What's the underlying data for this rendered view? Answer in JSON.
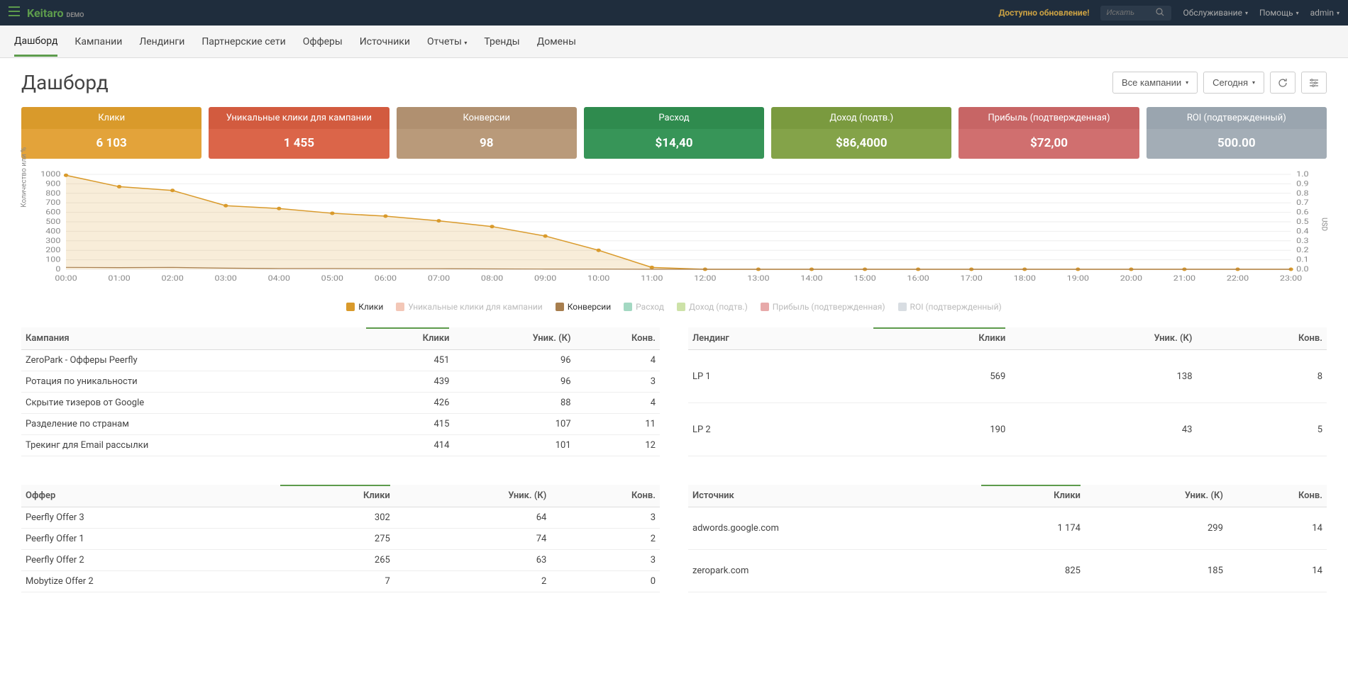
{
  "topbar": {
    "brand": "Keitaro",
    "demo": "DEMO",
    "update_notice": "Доступно обновление!",
    "search_placeholder": "Искать",
    "service": "Обслуживание",
    "help": "Помощь",
    "user": "admin"
  },
  "nav": {
    "items": [
      "Дашборд",
      "Кампании",
      "Лендинги",
      "Партнерские сети",
      "Офферы",
      "Источники",
      "Отчеты",
      "Тренды",
      "Домены"
    ]
  },
  "page": {
    "title": "Дашборд",
    "campaigns_dropdown": "Все кампании",
    "today_button": "Сегодня"
  },
  "stats": [
    {
      "label": "Клики",
      "value": "6 103",
      "cls": "card-orange"
    },
    {
      "label": "Уникальные клики для кампании",
      "value": "1 455",
      "cls": "card-red"
    },
    {
      "label": "Конверсии",
      "value": "98",
      "cls": "card-tan"
    },
    {
      "label": "Расход",
      "value": "$14,40",
      "cls": "card-green"
    },
    {
      "label": "Доход (подтв.)",
      "value": "$86,4000",
      "cls": "card-olive"
    },
    {
      "label": "Прибыль (подтвержденная)",
      "value": "$72,00",
      "cls": "card-salmon"
    },
    {
      "label": "ROI (подтвержденный)",
      "value": "500.00",
      "cls": "card-gray"
    }
  ],
  "chart_data": {
    "type": "area",
    "title": "",
    "xlabel": "",
    "ylabel_left": "Количество или %",
    "ylabel_right": "USD",
    "ylim_left": [
      0,
      1000
    ],
    "ylim_right": [
      0,
      1.0
    ],
    "y_ticks_left": [
      0,
      100,
      200,
      300,
      400,
      500,
      600,
      700,
      800,
      900,
      1000
    ],
    "y_ticks_right": [
      0.0,
      0.1,
      0.2,
      0.3,
      0.4,
      0.5,
      0.6,
      0.7,
      0.8,
      0.9,
      1.0
    ],
    "x": [
      "00:00",
      "01:00",
      "02:00",
      "03:00",
      "04:00",
      "05:00",
      "06:00",
      "07:00",
      "08:00",
      "09:00",
      "10:00",
      "11:00",
      "12:00",
      "13:00",
      "14:00",
      "15:00",
      "16:00",
      "17:00",
      "18:00",
      "19:00",
      "20:00",
      "21:00",
      "22:00",
      "23:00"
    ],
    "series": [
      {
        "name": "Клики",
        "color": "#d99a2b",
        "values": [
          990,
          870,
          830,
          670,
          640,
          590,
          560,
          510,
          450,
          350,
          200,
          20,
          0,
          0,
          0,
          0,
          0,
          0,
          0,
          0,
          0,
          0,
          0,
          0
        ]
      },
      {
        "name": "Уникальные клики для кампании",
        "color": "#f3c7b7",
        "values": [
          0,
          0,
          0,
          0,
          0,
          0,
          0,
          0,
          0,
          0,
          0,
          0,
          0,
          0,
          0,
          0,
          0,
          0,
          0,
          0,
          0,
          0,
          0,
          0
        ]
      },
      {
        "name": "Конверсии",
        "color": "#a77e4e",
        "values": [
          20,
          18,
          20,
          12,
          8,
          8,
          6,
          6,
          4,
          2,
          2,
          0,
          0,
          0,
          0,
          0,
          0,
          0,
          0,
          0,
          0,
          0,
          0,
          0
        ]
      },
      {
        "name": "Расход",
        "color": "#a3d8c2",
        "values": [
          0,
          0,
          0,
          0,
          0,
          0,
          0,
          0,
          0,
          0,
          0,
          0,
          0,
          0,
          0,
          0,
          0,
          0,
          0,
          0,
          0,
          0,
          0,
          0
        ]
      },
      {
        "name": "Доход (подтв.)",
        "color": "#cde2a8",
        "values": [
          0,
          0,
          0,
          0,
          0,
          0,
          0,
          0,
          0,
          0,
          0,
          0,
          0,
          0,
          0,
          0,
          0,
          0,
          0,
          0,
          0,
          0,
          0,
          0
        ]
      },
      {
        "name": "Прибыль (подтвержденная)",
        "color": "#e7a9a9",
        "values": [
          0,
          0,
          0,
          0,
          0,
          0,
          0,
          0,
          0,
          0,
          0,
          0,
          0,
          0,
          0,
          0,
          0,
          0,
          0,
          0,
          0,
          0,
          0,
          0
        ]
      },
      {
        "name": "ROI (подтвержденный)",
        "color": "#d8dde2",
        "values": [
          0,
          0,
          0,
          0,
          0,
          0,
          0,
          0,
          0,
          0,
          0,
          0,
          0,
          0,
          0,
          0,
          0,
          0,
          0,
          0,
          0,
          0,
          0,
          0
        ]
      }
    ]
  },
  "tables": {
    "campaigns": {
      "cols": [
        "Кампания",
        "Клики",
        "Уник. (К)",
        "Конв."
      ],
      "rows": [
        [
          "ZeroPark - Офферы Peerfly",
          "451",
          "96",
          "4"
        ],
        [
          "Ротация по уникальности",
          "439",
          "96",
          "3"
        ],
        [
          "Скрытие тизеров от Google",
          "426",
          "88",
          "4"
        ],
        [
          "Разделение по странам",
          "415",
          "107",
          "11"
        ],
        [
          "Трекинг для Email рассылки",
          "414",
          "101",
          "12"
        ]
      ]
    },
    "landings": {
      "cols": [
        "Лендинг",
        "Клики",
        "Уник. (К)",
        "Конв."
      ],
      "rows": [
        [
          "LP 1",
          "569",
          "138",
          "8"
        ],
        [
          "LP 2",
          "190",
          "43",
          "5"
        ]
      ]
    },
    "offers": {
      "cols": [
        "Оффер",
        "Клики",
        "Уник. (К)",
        "Конв."
      ],
      "rows": [
        [
          "Peerfly Offer 3",
          "302",
          "64",
          "3"
        ],
        [
          "Peerfly Offer 1",
          "275",
          "74",
          "2"
        ],
        [
          "Peerfly Offer 2",
          "265",
          "63",
          "3"
        ],
        [
          "Mobytize Offer 2",
          "7",
          "2",
          "0"
        ]
      ]
    },
    "sources": {
      "cols": [
        "Источник",
        "Клики",
        "Уник. (К)",
        "Конв."
      ],
      "rows": [
        [
          "adwords.google.com",
          "1 174",
          "299",
          "14"
        ],
        [
          "zeropark.com",
          "825",
          "185",
          "14"
        ]
      ]
    }
  }
}
